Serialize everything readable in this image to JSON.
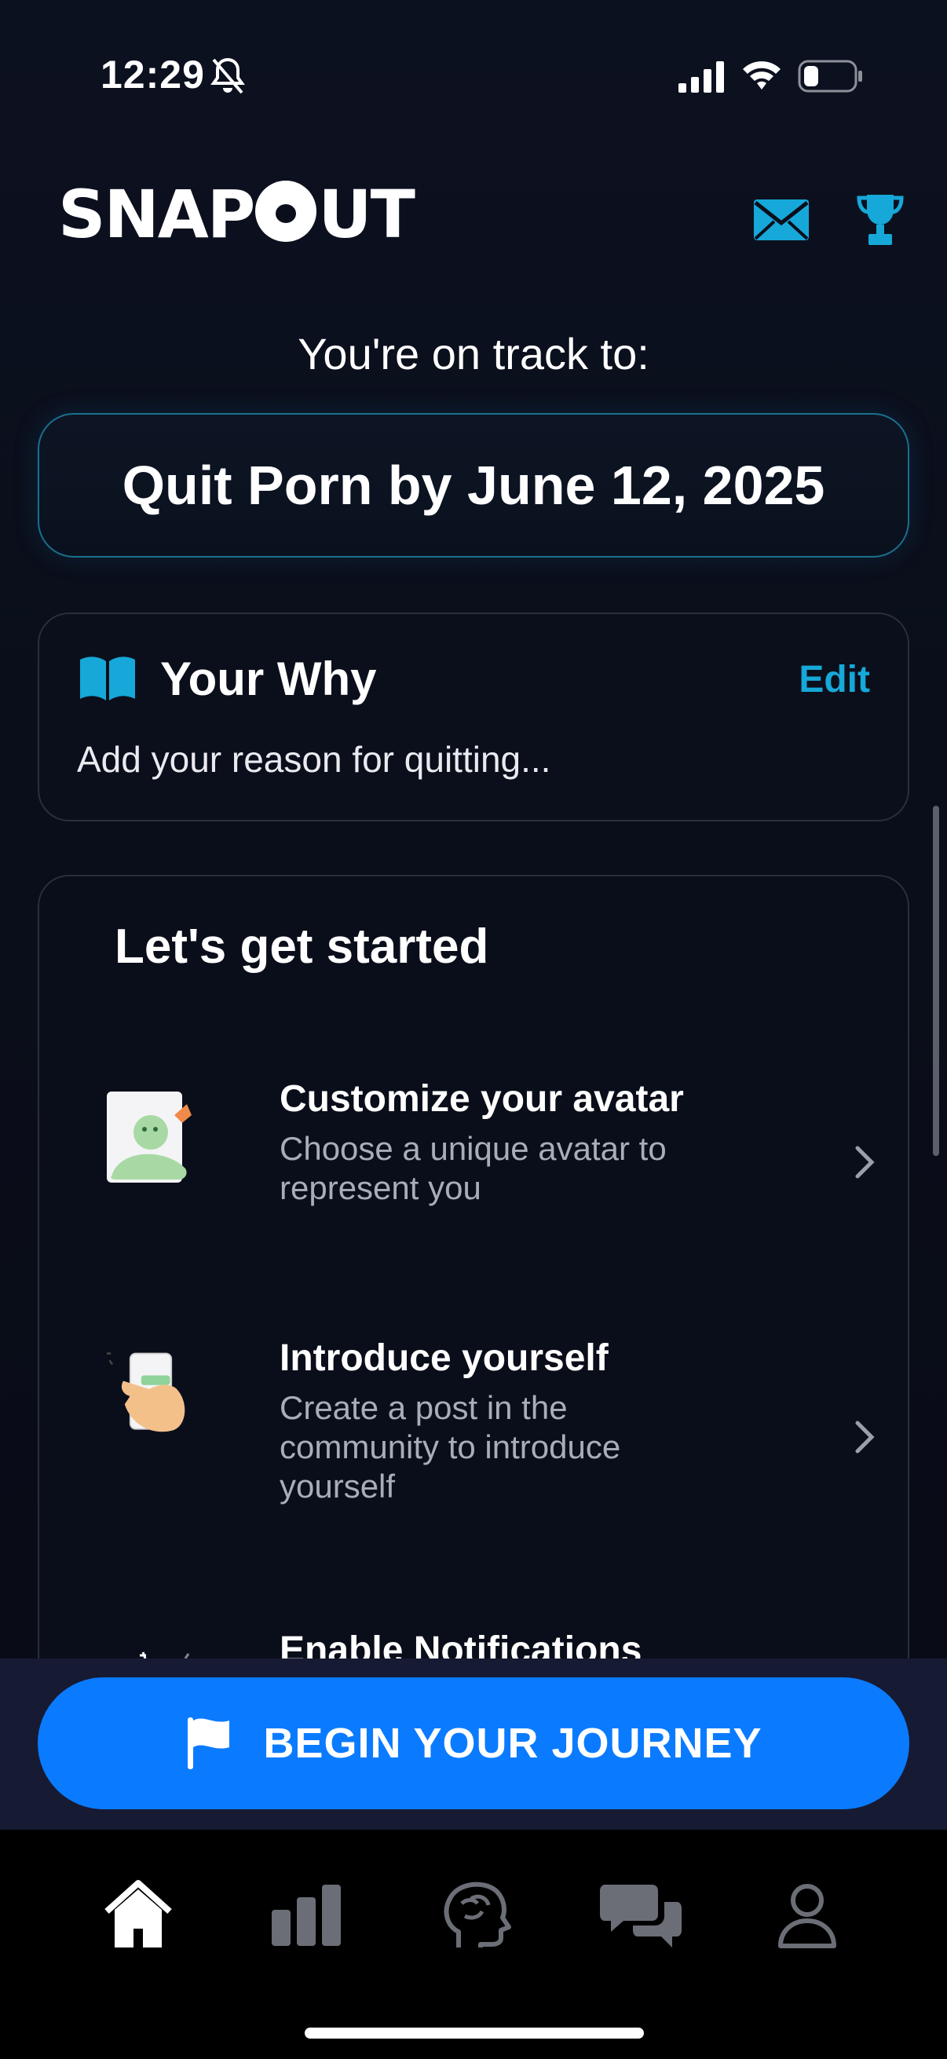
{
  "status_bar": {
    "time": "12:29"
  },
  "header": {
    "logo_text_left": "SNAP",
    "logo_text_right": "UT"
  },
  "track": {
    "label": "You're on track to:",
    "goal": "Quit Porn by June 12, 2025"
  },
  "why": {
    "title": "Your Why",
    "edit": "Edit",
    "placeholder": "Add your reason for quitting..."
  },
  "start": {
    "title": "Let's get started",
    "tasks": [
      {
        "title": "Customize your avatar",
        "desc": "Choose a unique avatar to represent you"
      },
      {
        "title": "Introduce yourself",
        "desc": "Create a post in the community to introduce yourself"
      },
      {
        "title": "Enable Notifications",
        "desc": ""
      }
    ]
  },
  "cta": {
    "label": "BEGIN YOUR JOURNEY"
  },
  "tabs": [
    "home-icon",
    "stats-icon",
    "brain-icon",
    "chat-icon",
    "profile-icon"
  ],
  "colors": {
    "accent": "#16a8d8",
    "primary": "#0a7bff",
    "background": "#0a0e1a"
  }
}
